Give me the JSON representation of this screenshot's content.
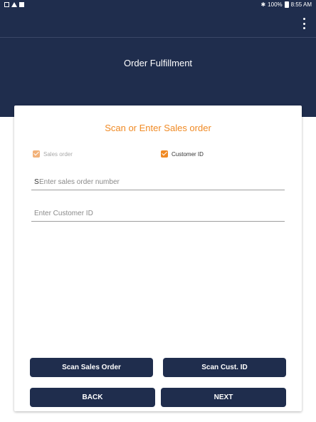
{
  "status_bar": {
    "left_icons": [
      "mail-icon",
      "alert-icon",
      "doc-icon"
    ],
    "right_icons": [
      "bluetooth-icon",
      "battery-icon"
    ],
    "battery": "100%",
    "time": "8:55 AM"
  },
  "app_bar": {
    "overflow_menu_icon": "more-vert-icon"
  },
  "header": {
    "title": "Order Fulfillment"
  },
  "card": {
    "title": "Scan or Enter Sales order",
    "checkboxes": {
      "sales_order": {
        "label": "Sales order",
        "checked": true,
        "disabled": true
      },
      "customer_id": {
        "label": "Customer ID",
        "checked": true,
        "disabled": false
      }
    },
    "sales_order_field": {
      "value": "S",
      "placeholder": "Enter sales order number"
    },
    "customer_id_field": {
      "value": "",
      "placeholder": "Enter Customer ID"
    },
    "buttons": {
      "scan_sales_order": "Scan Sales Order",
      "scan_cust_id": "Scan Cust. ID",
      "back": "BACK",
      "next": "NEXT"
    }
  },
  "colors": {
    "primary": "#1f2d4d",
    "accent": "#f08a24"
  }
}
